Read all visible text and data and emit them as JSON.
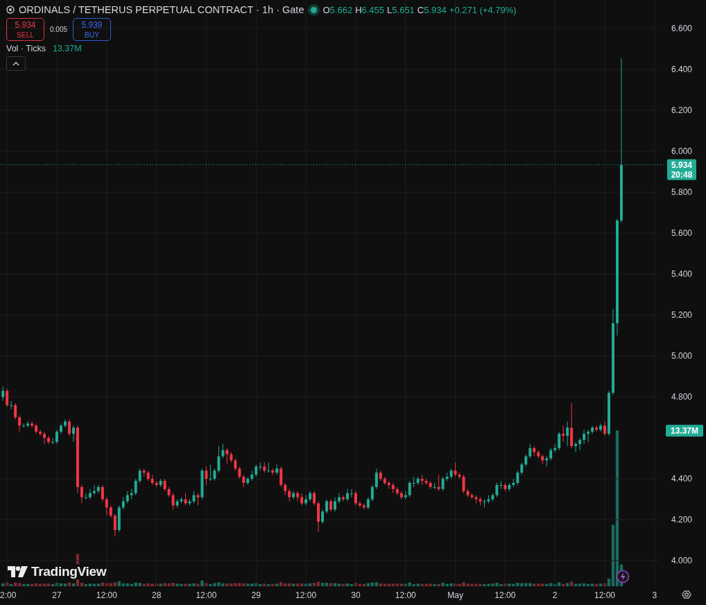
{
  "header": {
    "title": "ORDINALS / TETHERUS PERPETUAL CONTRACT · 1h · Gate",
    "market_open": true,
    "ohlc": [
      {
        "label": "O",
        "value": "5.662"
      },
      {
        "label": "H",
        "value": "6.455"
      },
      {
        "label": "L",
        "value": "5.651"
      },
      {
        "label": "C",
        "value": "5.934"
      }
    ],
    "change": "+0.271 (+4.79%)"
  },
  "trade": {
    "sell": {
      "price": "5.934",
      "label": "SELL"
    },
    "spread": "0.005",
    "buy": {
      "price": "5.939",
      "label": "BUY"
    }
  },
  "volume_legend": {
    "label": "Vol · Ticks",
    "value": "13.37M"
  },
  "chart": {
    "chart_data": {
      "type": "candlestick",
      "ylim": [
        3.875,
        6.739
      ],
      "grid": true,
      "categories": [
        null,
        "2:00",
        null,
        null,
        null,
        null,
        null,
        null,
        null,
        null,
        null,
        null,
        null,
        "27",
        null,
        null,
        null,
        null,
        null,
        null,
        null,
        null,
        null,
        null,
        null,
        "12:00",
        null,
        null,
        null,
        null,
        null,
        null,
        null,
        null,
        null,
        null,
        null,
        "28",
        null,
        null,
        null,
        null,
        null,
        null,
        null,
        null,
        null,
        null,
        null,
        "12:00",
        null,
        null,
        null,
        null,
        null,
        null,
        null,
        null,
        null,
        null,
        null,
        "29",
        null,
        null,
        null,
        null,
        null,
        null,
        null,
        null,
        null,
        null,
        null,
        "12:00",
        null,
        null,
        null,
        null,
        null,
        null,
        null,
        null,
        null,
        null,
        null,
        "30",
        null,
        null,
        null,
        null,
        null,
        null,
        null,
        null,
        null,
        null,
        null,
        "12:00",
        null,
        null,
        null,
        null,
        null,
        null,
        null,
        null,
        null,
        null,
        null,
        "May",
        null,
        null,
        null,
        null,
        null,
        null,
        null,
        null,
        null,
        null,
        null,
        "12:00",
        null,
        null,
        null,
        null,
        null,
        null,
        null,
        null,
        null,
        null,
        null,
        "2",
        null,
        null,
        null,
        null,
        null,
        null,
        null,
        null,
        null,
        null,
        null,
        "12:00",
        null,
        null,
        null,
        null,
        null,
        null,
        null,
        null,
        null,
        null,
        null,
        "3",
        null
      ],
      "ohlc": [
        [
          4.8,
          4.85,
          4.78,
          4.83
        ],
        [
          4.83,
          4.84,
          4.75,
          4.76
        ],
        [
          4.76,
          4.78,
          4.74,
          4.76
        ],
        [
          4.76,
          4.77,
          4.69,
          4.7
        ],
        [
          4.7,
          4.71,
          4.63,
          4.66
        ],
        [
          4.66,
          4.67,
          4.65,
          4.66
        ],
        [
          4.66,
          4.68,
          4.65,
          4.67
        ],
        [
          4.67,
          4.68,
          4.65,
          4.66
        ],
        [
          4.66,
          4.67,
          4.62,
          4.63
        ],
        [
          4.63,
          4.64,
          4.61,
          4.62
        ],
        [
          4.62,
          4.63,
          4.57,
          4.6
        ],
        [
          4.6,
          4.61,
          4.57,
          4.58
        ],
        [
          4.58,
          4.6,
          4.57,
          4.58
        ],
        [
          4.58,
          4.64,
          4.57,
          4.63
        ],
        [
          4.63,
          4.67,
          4.62,
          4.66
        ],
        [
          4.66,
          4.69,
          4.65,
          4.68
        ],
        [
          4.68,
          4.69,
          4.61,
          4.62
        ],
        [
          4.62,
          4.66,
          4.58,
          4.65
        ],
        [
          4.65,
          4.66,
          4.33,
          4.36
        ],
        [
          4.36,
          4.37,
          4.28,
          4.31
        ],
        [
          4.31,
          4.33,
          4.3,
          4.31
        ],
        [
          4.31,
          4.35,
          4.3,
          4.33
        ],
        [
          4.33,
          4.37,
          4.32,
          4.34
        ],
        [
          4.34,
          4.37,
          4.33,
          4.36
        ],
        [
          4.36,
          4.37,
          4.29,
          4.3
        ],
        [
          4.3,
          4.31,
          4.22,
          4.26
        ],
        [
          4.26,
          4.27,
          4.21,
          4.22
        ],
        [
          4.22,
          4.23,
          4.12,
          4.15
        ],
        [
          4.15,
          4.27,
          4.14,
          4.26
        ],
        [
          4.26,
          4.31,
          4.25,
          4.29
        ],
        [
          4.29,
          4.34,
          4.28,
          4.32
        ],
        [
          4.32,
          4.35,
          4.3,
          4.33
        ],
        [
          4.33,
          4.4,
          4.32,
          4.39
        ],
        [
          4.39,
          4.45,
          4.38,
          4.44
        ],
        [
          4.44,
          4.45,
          4.41,
          4.43
        ],
        [
          4.43,
          4.44,
          4.39,
          4.4
        ],
        [
          4.4,
          4.42,
          4.37,
          4.38
        ],
        [
          4.38,
          4.39,
          4.36,
          4.37
        ],
        [
          4.37,
          4.4,
          4.36,
          4.39
        ],
        [
          4.39,
          4.4,
          4.34,
          4.35
        ],
        [
          4.35,
          4.36,
          4.31,
          4.32
        ],
        [
          4.32,
          4.33,
          4.25,
          4.27
        ],
        [
          4.27,
          4.3,
          4.26,
          4.29
        ],
        [
          4.29,
          4.31,
          4.28,
          4.3
        ],
        [
          4.3,
          4.33,
          4.27,
          4.28
        ],
        [
          4.28,
          4.3,
          4.27,
          4.29
        ],
        [
          4.29,
          4.34,
          4.28,
          4.32
        ],
        [
          4.32,
          4.33,
          4.27,
          4.31
        ],
        [
          4.31,
          4.45,
          4.3,
          4.44
        ],
        [
          4.44,
          4.46,
          4.37,
          4.4
        ],
        [
          4.4,
          4.47,
          4.39,
          4.4
        ],
        [
          4.4,
          4.45,
          4.39,
          4.44
        ],
        [
          4.44,
          4.56,
          4.43,
          4.51
        ],
        [
          4.51,
          4.57,
          4.5,
          4.54
        ],
        [
          4.54,
          4.55,
          4.47,
          4.52
        ],
        [
          4.52,
          4.53,
          4.48,
          4.49
        ],
        [
          4.49,
          4.5,
          4.44,
          4.45
        ],
        [
          4.45,
          4.46,
          4.4,
          4.41
        ],
        [
          4.41,
          4.42,
          4.36,
          4.38
        ],
        [
          4.38,
          4.41,
          4.37,
          4.4
        ],
        [
          4.4,
          4.44,
          4.39,
          4.42
        ],
        [
          4.42,
          4.47,
          4.41,
          4.46
        ],
        [
          4.46,
          4.48,
          4.44,
          4.46
        ],
        [
          4.46,
          4.48,
          4.43,
          4.44
        ],
        [
          4.44,
          4.48,
          4.43,
          4.44
        ],
        [
          4.44,
          4.45,
          4.42,
          4.43
        ],
        [
          4.43,
          4.47,
          4.42,
          4.45
        ],
        [
          4.45,
          4.46,
          4.36,
          4.37
        ],
        [
          4.37,
          4.38,
          4.32,
          4.34
        ],
        [
          4.34,
          4.35,
          4.29,
          4.31
        ],
        [
          4.31,
          4.34,
          4.3,
          4.33
        ],
        [
          4.33,
          4.34,
          4.29,
          4.31
        ],
        [
          4.31,
          4.33,
          4.27,
          4.28
        ],
        [
          4.28,
          4.32,
          4.27,
          4.3
        ],
        [
          4.3,
          4.34,
          4.29,
          4.33
        ],
        [
          4.33,
          4.34,
          4.27,
          4.28
        ],
        [
          4.28,
          4.29,
          4.14,
          4.19
        ],
        [
          4.19,
          4.25,
          4.18,
          4.24
        ],
        [
          4.24,
          4.3,
          4.23,
          4.29
        ],
        [
          4.29,
          4.3,
          4.24,
          4.25
        ],
        [
          4.25,
          4.31,
          4.24,
          4.29
        ],
        [
          4.29,
          4.33,
          4.28,
          4.31
        ],
        [
          4.31,
          4.32,
          4.29,
          4.3
        ],
        [
          4.3,
          4.35,
          4.29,
          4.33
        ],
        [
          4.33,
          4.35,
          4.31,
          4.33
        ],
        [
          4.33,
          4.34,
          4.27,
          4.28
        ],
        [
          4.28,
          4.29,
          4.26,
          4.27
        ],
        [
          4.27,
          4.28,
          4.25,
          4.26
        ],
        [
          4.26,
          4.31,
          4.25,
          4.3
        ],
        [
          4.3,
          4.37,
          4.29,
          4.36
        ],
        [
          4.36,
          4.45,
          4.35,
          4.43
        ],
        [
          4.43,
          4.44,
          4.39,
          4.4
        ],
        [
          4.4,
          4.41,
          4.37,
          4.38
        ],
        [
          4.38,
          4.39,
          4.35,
          4.37
        ],
        [
          4.37,
          4.38,
          4.33,
          4.35
        ],
        [
          4.35,
          4.36,
          4.32,
          4.33
        ],
        [
          4.33,
          4.34,
          4.3,
          4.31
        ],
        [
          4.31,
          4.34,
          4.3,
          4.32
        ],
        [
          4.32,
          4.39,
          4.31,
          4.38
        ],
        [
          4.38,
          4.41,
          4.36,
          4.38
        ],
        [
          4.38,
          4.41,
          4.37,
          4.4
        ],
        [
          4.4,
          4.42,
          4.37,
          4.39
        ],
        [
          4.39,
          4.4,
          4.37,
          4.38
        ],
        [
          4.38,
          4.39,
          4.35,
          4.36
        ],
        [
          4.36,
          4.38,
          4.35,
          4.36
        ],
        [
          4.36,
          4.42,
          4.34,
          4.35
        ],
        [
          4.35,
          4.41,
          4.34,
          4.4
        ],
        [
          4.4,
          4.43,
          4.39,
          4.41
        ],
        [
          4.41,
          4.45,
          4.4,
          4.44
        ],
        [
          4.44,
          4.48,
          4.41,
          4.42
        ],
        [
          4.42,
          4.43,
          4.4,
          4.41
        ],
        [
          4.41,
          4.42,
          4.33,
          4.34
        ],
        [
          4.34,
          4.35,
          4.31,
          4.32
        ],
        [
          4.32,
          4.33,
          4.3,
          4.31
        ],
        [
          4.31,
          4.32,
          4.28,
          4.3
        ],
        [
          4.3,
          4.31,
          4.27,
          4.29
        ],
        [
          4.29,
          4.3,
          4.26,
          4.29
        ],
        [
          4.29,
          4.32,
          4.28,
          4.3
        ],
        [
          4.3,
          4.33,
          4.29,
          4.32
        ],
        [
          4.32,
          4.38,
          4.31,
          4.37
        ],
        [
          4.37,
          4.39,
          4.35,
          4.37
        ],
        [
          4.37,
          4.38,
          4.34,
          4.35
        ],
        [
          4.35,
          4.38,
          4.34,
          4.37
        ],
        [
          4.37,
          4.4,
          4.36,
          4.38
        ],
        [
          4.38,
          4.44,
          4.37,
          4.43
        ],
        [
          4.43,
          4.48,
          4.42,
          4.47
        ],
        [
          4.47,
          4.52,
          4.46,
          4.51
        ],
        [
          4.51,
          4.57,
          4.5,
          4.55
        ],
        [
          4.55,
          4.56,
          4.51,
          4.53
        ],
        [
          4.53,
          4.54,
          4.5,
          4.51
        ],
        [
          4.51,
          4.52,
          4.47,
          4.49
        ],
        [
          4.49,
          4.51,
          4.46,
          4.5
        ],
        [
          4.5,
          4.55,
          4.49,
          4.54
        ],
        [
          4.54,
          4.57,
          4.53,
          4.55
        ],
        [
          4.55,
          4.63,
          4.54,
          4.62
        ],
        [
          4.62,
          4.66,
          4.58,
          4.61
        ],
        [
          4.61,
          4.68,
          4.56,
          4.65
        ],
        [
          4.65,
          4.77,
          4.55,
          4.56
        ],
        [
          4.56,
          4.58,
          4.53,
          4.57
        ],
        [
          4.57,
          4.6,
          4.54,
          4.59
        ],
        [
          4.59,
          4.64,
          4.57,
          4.62
        ],
        [
          4.62,
          4.64,
          4.58,
          4.63
        ],
        [
          4.63,
          4.66,
          4.62,
          4.65
        ],
        [
          4.65,
          4.66,
          4.63,
          4.64
        ],
        [
          4.64,
          4.67,
          4.63,
          4.66
        ],
        [
          4.66,
          4.68,
          4.61,
          4.62
        ],
        [
          4.62,
          4.83,
          4.61,
          4.82
        ],
        [
          4.82,
          5.23,
          4.81,
          5.16
        ],
        [
          5.16,
          5.67,
          5.1,
          5.662
        ],
        [
          5.662,
          6.455,
          5.651,
          5.934
        ],
        null,
        null,
        null,
        null,
        null,
        null,
        null,
        null,
        null
      ],
      "ref_lines": [
        {
          "axis": "y",
          "value": 5.934,
          "color": "#22ab94",
          "label": "5.934"
        }
      ],
      "yticks": [
        {
          "value": 4,
          "label": "4.000"
        },
        {
          "value": 4.2,
          "label": "4.200"
        },
        {
          "value": 4.4,
          "label": "4.400"
        },
        {
          "value": 4.8,
          "label": "4.800"
        },
        {
          "value": 5,
          "label": "5.000"
        },
        {
          "value": 5.2,
          "label": "5.200"
        },
        {
          "value": 5.4,
          "label": "5.400"
        },
        {
          "value": 5.6,
          "label": "5.600"
        },
        {
          "value": 5.8,
          "label": "5.800"
        },
        {
          "value": 6,
          "label": "6.000"
        },
        {
          "value": 6.2,
          "label": "6.200"
        },
        {
          "value": 6.4,
          "label": "6.400"
        },
        {
          "value": 6.6,
          "label": "6.600"
        }
      ]
    },
    "last_price": {
      "countdown": "20:48"
    },
    "volume_label": "13.37M"
  },
  "branding": "TradingView"
}
